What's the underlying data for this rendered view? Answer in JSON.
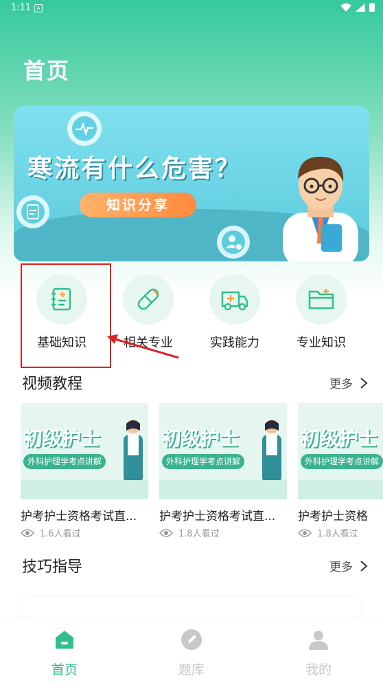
{
  "status_bar": {
    "time": "1:11",
    "badge": "A"
  },
  "page": {
    "title": "首页"
  },
  "banner": {
    "headline": "寒流有什么危害？",
    "pill": "知识分享"
  },
  "quick_nav": [
    {
      "label": "基础知识",
      "icon": "notebook-icon"
    },
    {
      "label": "相关专业",
      "icon": "pill-icon"
    },
    {
      "label": "实践能力",
      "icon": "ambulance-icon"
    },
    {
      "label": "专业知识",
      "icon": "folder-icon"
    }
  ],
  "videos_section": {
    "title": "视频教程",
    "more": "更多",
    "items": [
      {
        "thumb_title": "初级护士",
        "thumb_sub": "外科护理学考点讲解",
        "title": "护考护士资格考试直...",
        "views": "1.6人看过"
      },
      {
        "thumb_title": "初级护士",
        "thumb_sub": "外科护理学考点讲解",
        "title": "护考护士资格考试直...",
        "views": "1.8人看过"
      },
      {
        "thumb_title": "初级护士",
        "thumb_sub": "外科护理学考点讲解",
        "title": "护考护士资格",
        "views": "1.8人看过"
      }
    ]
  },
  "tips_section": {
    "title": "技巧指导",
    "more": "更多"
  },
  "tabbar": {
    "items": [
      {
        "label": "首页",
        "active": true
      },
      {
        "label": "题库",
        "active": false
      },
      {
        "label": "我的",
        "active": false
      }
    ],
    "active_color": "#2fbf8c",
    "inactive_color": "#c8c8c8"
  }
}
